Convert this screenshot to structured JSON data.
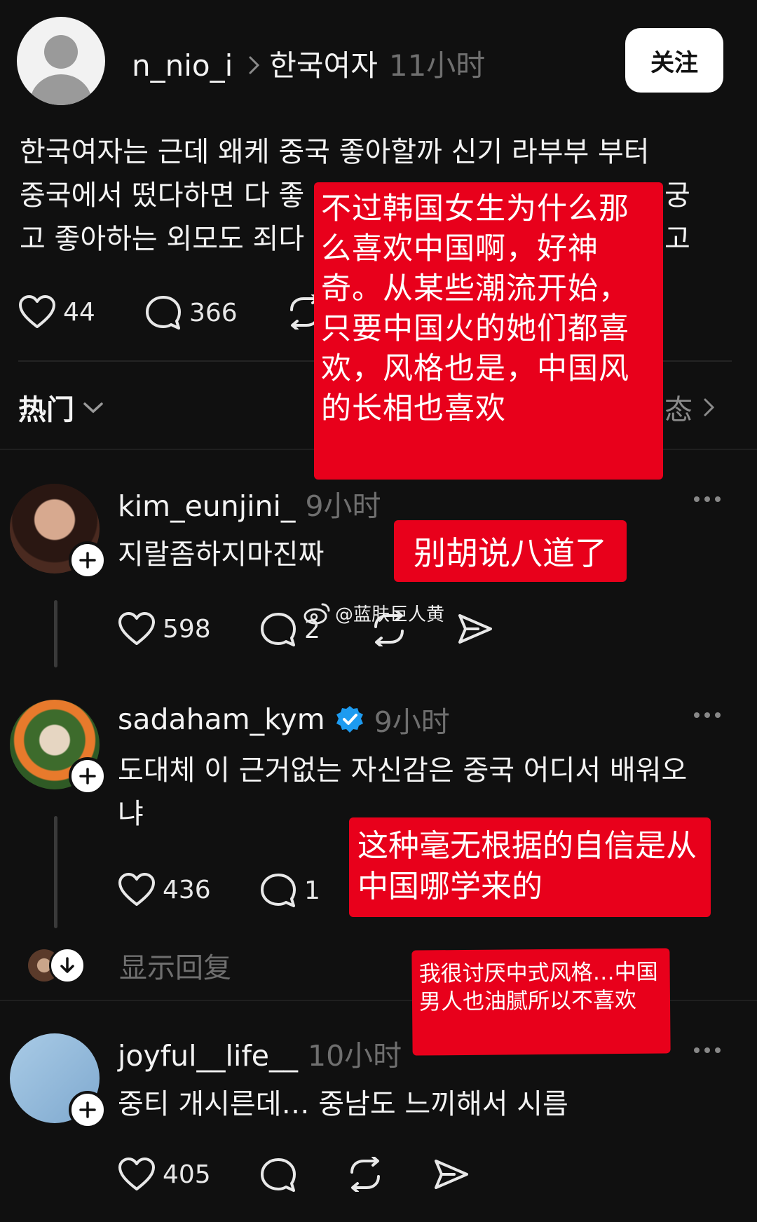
{
  "post": {
    "author": "n_nio_i",
    "community": "한국여자",
    "time": "11小时",
    "follow_label": "关注",
    "lines": [
      "한국여자는 근데 왜케 중국 좋아할까 신기 라부부 부터",
      "중국에서 떴다하면 다 좋",
      "고 좋아하는 외모도 죄다"
    ],
    "line2_tail": "궁",
    "line3_tail": "고",
    "likes": "44",
    "comments": "366"
  },
  "sort": {
    "label": "热门",
    "right_label": "态"
  },
  "annotations": {
    "post_translation": "不过韩国女生为什么那么喜欢中国啊，好神奇。从某些潮流开始，只要中国火的她们都喜欢，风格也是，中国风的长相也喜欢",
    "reply1_translation": "别胡说八道了",
    "reply2_translation": "这种毫无根据的自信是从中国哪学来的",
    "reply3_translation": "我很讨厌中式风格…中国男人也油腻所以不喜欢"
  },
  "watermark": "@蓝肤巨人黄",
  "replies": [
    {
      "author": "kim_eunjini_",
      "time": "9小时",
      "text": "지랄좀하지마진짜",
      "likes": "598",
      "comments": "2"
    },
    {
      "author": "sadaham_kym",
      "time": "9小时",
      "text_line1": "도대체 이 근거없는 자신감은 중국 어디서 배워오",
      "text_line2": "냐",
      "likes": "436",
      "comments": "1",
      "show_replies": "显示回复"
    },
    {
      "author": "joyful__life__",
      "time": "10小时",
      "text": "중티 개시른데… 중남도 느끼해서 시름",
      "likes": "405"
    }
  ],
  "colors": {
    "background": "#101010",
    "annotation_red": "#e8001b",
    "verified_blue": "#1d9bf0",
    "muted_text": "#6f6f6f"
  }
}
